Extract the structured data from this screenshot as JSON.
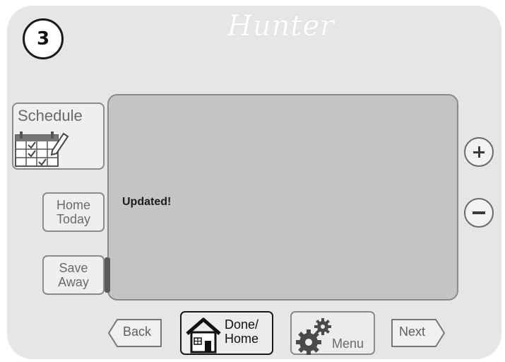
{
  "step_number": "3",
  "brand": "Hunter",
  "screen": {
    "message": "Updated!"
  },
  "side_buttons": {
    "schedule": "Schedule",
    "home_today": [
      "Home",
      "Today"
    ],
    "save_away": [
      "Save",
      "Away"
    ]
  },
  "adjust": {
    "plus": "+",
    "minus": "−"
  },
  "bottom_nav": {
    "back": "Back",
    "done_home": [
      "Done/",
      "Home"
    ],
    "menu": "Menu",
    "next": "Next"
  },
  "icons": {
    "schedule": "calendar-pencil-icon",
    "done_home": "house-icon",
    "menu": "gear-icon"
  },
  "colors": {
    "device_bg": "#e6e6e6",
    "screen_bg": "#c4c4c4",
    "button_text": "#6a6a6a"
  }
}
